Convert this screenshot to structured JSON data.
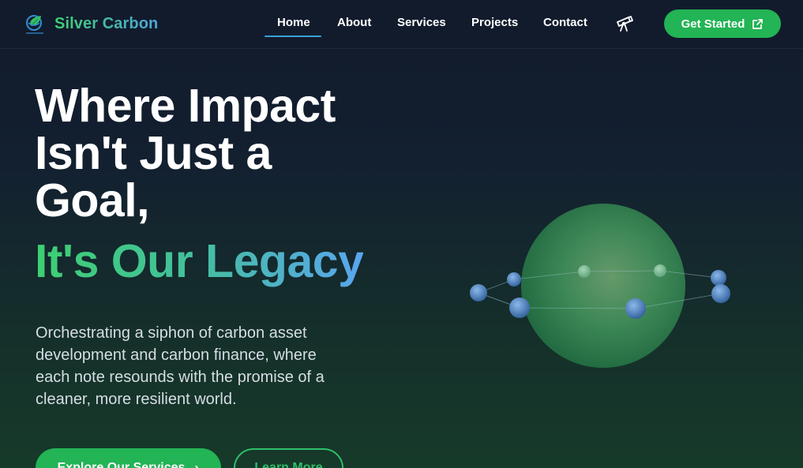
{
  "brand": {
    "name": "Silver Carbon",
    "logo_icon": "leaf-globe-icon"
  },
  "nav": {
    "items": [
      {
        "label": "Home",
        "active": true
      },
      {
        "label": "About"
      },
      {
        "label": "Services"
      },
      {
        "label": "Projects"
      },
      {
        "label": "Contact"
      }
    ],
    "extra_icon": "telescope-icon",
    "cta": {
      "label": "Get Started",
      "icon": "external-link-icon"
    }
  },
  "hero": {
    "title": "Where Impact Isn't Just a Goal,",
    "accent": "It's Our Legacy",
    "description": "Orchestrating a siphon of carbon asset development and carbon finance, where each note resounds with the promise of a cleaner, more resilient world.",
    "primary_button": {
      "label": "Explore Our Services",
      "icon": "chevron-right-icon"
    },
    "secondary_button": {
      "label": "Learn More"
    }
  },
  "colors": {
    "accent_green": "#22b455",
    "accent_blue": "#5aa5ee",
    "nav_bg": "#121b2c",
    "active_underline": "#3a9fd6"
  }
}
